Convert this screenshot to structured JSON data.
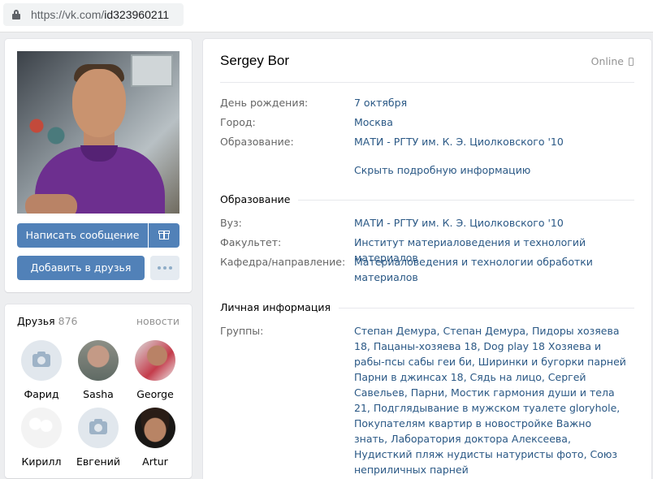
{
  "browser": {
    "url_host": "https://vk.com/",
    "url_path": "id323960211"
  },
  "profile": {
    "name": "Sergey Bor",
    "status": "Online",
    "buttons": {
      "message": "Написать сообщение",
      "add_friend": "Добавить в друзья"
    },
    "short_info": [
      {
        "label": "День рождения:",
        "value": "7 октября"
      },
      {
        "label": "Город:",
        "value": "Москва"
      },
      {
        "label": "Образование:",
        "value": "МАТИ - РГТУ им. К. Э. Циолковского '10"
      }
    ],
    "toggle_link": "Скрыть подробную информацию",
    "education": {
      "title": "Образование",
      "rows": [
        {
          "label": "Вуз:",
          "value": "МАТИ - РГТУ им. К. Э. Циолковского '10"
        },
        {
          "label": "Факультет:",
          "value": "Институт материаловедения и технологий материалов"
        },
        {
          "label": "Кафедра/направление:",
          "value": "Материаловедения и технологии обработки материалов"
        }
      ]
    },
    "personal": {
      "title": "Личная информация",
      "groups_label": "Группы:",
      "groups_value": "Степан Демура, Степан Демура, Пидоры хозяева 18, Пацаны-хозяева 18, Dog play 18 Хозяева и рабы-псы сабы геи би, Ширинки и бугорки парней Парни в джинсах 18, Сядь на лицо, Сергей Савельев, Парни, Мостик гармония души и тела 21, Подглядывание в мужском туалете gloryhole, Покупателям квартир в новостройке Важно знать, Лаборатория доктора Алексеева, Нудисткий пляж нудисты натуристы фото, Союз неприличных парней"
    }
  },
  "friends": {
    "title": "Друзья",
    "count": "876",
    "news_link": "новости",
    "items": [
      {
        "name": "Фарид",
        "avatar": "camera-placeholder"
      },
      {
        "name": "Sasha",
        "avatar": "photo"
      },
      {
        "name": "George",
        "avatar": "photo"
      },
      {
        "name": "Кирилл",
        "avatar": "photo"
      },
      {
        "name": "Евгений",
        "avatar": "camera-placeholder"
      },
      {
        "name": "Artur",
        "avatar": "photo"
      }
    ]
  },
  "colors": {
    "page_bg": "#edeef0",
    "button_blue": "#5181b8",
    "link_blue": "#2a5885",
    "label_gray": "#656565",
    "muted_gray": "#939393"
  }
}
